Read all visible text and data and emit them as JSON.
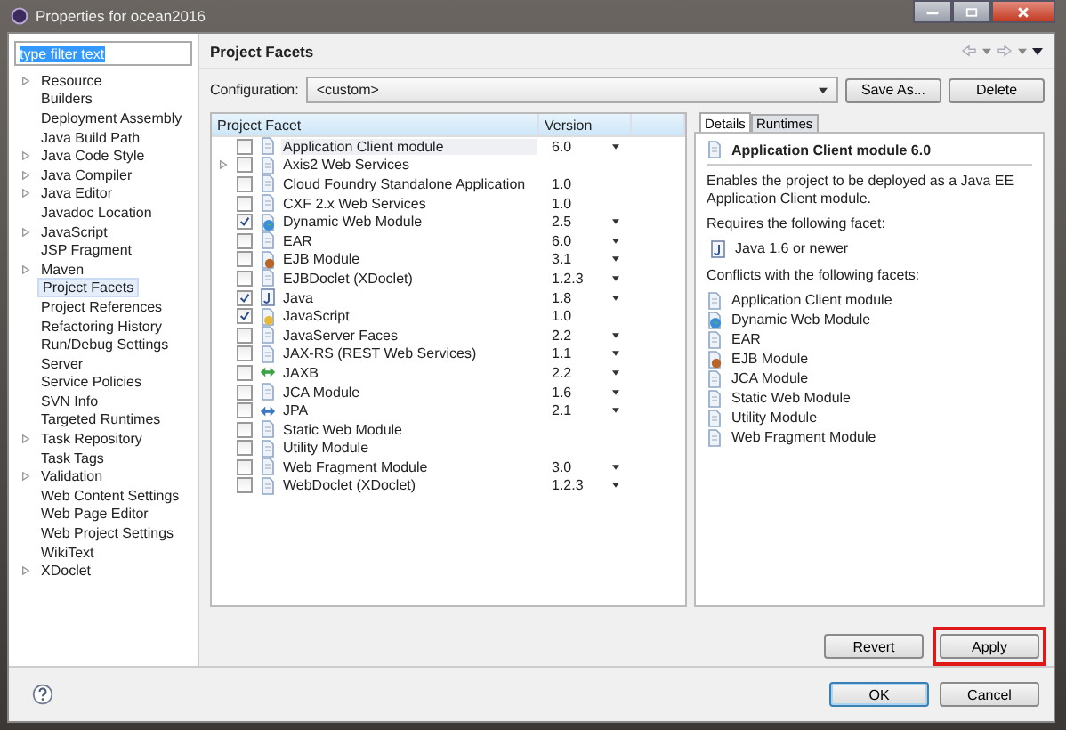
{
  "window": {
    "title": "Properties for ocean2016"
  },
  "filter": {
    "value": "type filter text"
  },
  "sidebar": {
    "items": [
      {
        "label": "Resource",
        "expandable": true,
        "selected": false
      },
      {
        "label": "Builders",
        "expandable": false,
        "selected": false
      },
      {
        "label": "Deployment Assembly",
        "expandable": false,
        "selected": false
      },
      {
        "label": "Java Build Path",
        "expandable": false,
        "selected": false
      },
      {
        "label": "Java Code Style",
        "expandable": true,
        "selected": false
      },
      {
        "label": "Java Compiler",
        "expandable": true,
        "selected": false
      },
      {
        "label": "Java Editor",
        "expandable": true,
        "selected": false
      },
      {
        "label": "Javadoc Location",
        "expandable": false,
        "selected": false
      },
      {
        "label": "JavaScript",
        "expandable": true,
        "selected": false
      },
      {
        "label": "JSP Fragment",
        "expandable": false,
        "selected": false
      },
      {
        "label": "Maven",
        "expandable": true,
        "selected": false
      },
      {
        "label": "Project Facets",
        "expandable": false,
        "selected": true
      },
      {
        "label": "Project References",
        "expandable": false,
        "selected": false
      },
      {
        "label": "Refactoring History",
        "expandable": false,
        "selected": false
      },
      {
        "label": "Run/Debug Settings",
        "expandable": false,
        "selected": false
      },
      {
        "label": "Server",
        "expandable": false,
        "selected": false
      },
      {
        "label": "Service Policies",
        "expandable": false,
        "selected": false
      },
      {
        "label": "SVN Info",
        "expandable": false,
        "selected": false
      },
      {
        "label": "Targeted Runtimes",
        "expandable": false,
        "selected": false
      },
      {
        "label": "Task Repository",
        "expandable": true,
        "selected": false
      },
      {
        "label": "Task Tags",
        "expandable": false,
        "selected": false
      },
      {
        "label": "Validation",
        "expandable": true,
        "selected": false
      },
      {
        "label": "Web Content Settings",
        "expandable": false,
        "selected": false
      },
      {
        "label": "Web Page Editor",
        "expandable": false,
        "selected": false
      },
      {
        "label": "Web Project Settings",
        "expandable": false,
        "selected": false
      },
      {
        "label": "WikiText",
        "expandable": false,
        "selected": false
      },
      {
        "label": "XDoclet",
        "expandable": true,
        "selected": false
      }
    ]
  },
  "page": {
    "title": "Project Facets",
    "configuration_label": "Configuration:",
    "configuration_value": "<custom>",
    "buttons": [
      "Save As...",
      "Delete"
    ]
  },
  "facets": {
    "columns": [
      "Project Facet",
      "Version"
    ],
    "rows": [
      {
        "name": "Application Client module",
        "kind": "document",
        "checked": false,
        "expandable": false,
        "selected": true,
        "version": "6.0",
        "has_versions": true
      },
      {
        "name": "Axis2 Web Services",
        "kind": "document",
        "checked": false,
        "expandable": true,
        "selected": false,
        "has_versions": false
      },
      {
        "name": "Cloud Foundry Standalone Application",
        "kind": "document",
        "checked": false,
        "expandable": false,
        "selected": false,
        "version": "1.0",
        "has_versions": false
      },
      {
        "name": "CXF 2.x Web Services",
        "kind": "document",
        "checked": false,
        "expandable": false,
        "selected": false,
        "version": "1.0",
        "has_versions": false
      },
      {
        "name": "Dynamic Web Module",
        "kind": "globe",
        "checked": true,
        "expandable": false,
        "selected": false,
        "version": "2.5",
        "has_versions": true
      },
      {
        "name": "EAR",
        "kind": "document",
        "checked": false,
        "expandable": false,
        "selected": false,
        "version": "6.0",
        "has_versions": true
      },
      {
        "name": "EJB Module",
        "kind": "bean",
        "checked": false,
        "expandable": false,
        "selected": false,
        "version": "3.1",
        "has_versions": true
      },
      {
        "name": "EJBDoclet (XDoclet)",
        "kind": "document",
        "checked": false,
        "expandable": false,
        "selected": false,
        "version": "1.2.3",
        "has_versions": true
      },
      {
        "name": "Java",
        "kind": "java",
        "checked": true,
        "expandable": false,
        "selected": false,
        "version": "1.8",
        "has_versions": true
      },
      {
        "name": "JavaScript",
        "kind": "script",
        "checked": true,
        "expandable": false,
        "selected": false,
        "version": "1.0",
        "has_versions": false
      },
      {
        "name": "JavaServer Faces",
        "kind": "document",
        "checked": false,
        "expandable": false,
        "selected": false,
        "version": "2.2",
        "has_versions": true
      },
      {
        "name": "JAX-RS (REST Web Services)",
        "kind": "document",
        "checked": false,
        "expandable": false,
        "selected": false,
        "version": "1.1",
        "has_versions": true
      },
      {
        "name": "JAXB",
        "kind": "green-arrows",
        "checked": false,
        "expandable": false,
        "selected": false,
        "version": "2.2",
        "has_versions": true
      },
      {
        "name": "JCA Module",
        "kind": "document",
        "checked": false,
        "expandable": false,
        "selected": false,
        "version": "1.6",
        "has_versions": true
      },
      {
        "name": "JPA",
        "kind": "blue-arrows",
        "checked": false,
        "expandable": false,
        "selected": false,
        "version": "2.1",
        "has_versions": true
      },
      {
        "name": "Static Web Module",
        "kind": "document",
        "checked": false,
        "expandable": false,
        "selected": false,
        "has_versions": false
      },
      {
        "name": "Utility Module",
        "kind": "document",
        "checked": false,
        "expandable": false,
        "selected": false,
        "has_versions": false
      },
      {
        "name": "Web Fragment Module",
        "kind": "document",
        "checked": false,
        "expandable": false,
        "selected": false,
        "version": "3.0",
        "has_versions": true
      },
      {
        "name": "WebDoclet (XDoclet)",
        "kind": "document",
        "checked": false,
        "expandable": false,
        "selected": false,
        "version": "1.2.3",
        "has_versions": true
      }
    ]
  },
  "details": {
    "tabs": [
      {
        "label": "Details",
        "selected": true
      },
      {
        "label": "Runtimes",
        "selected": false
      }
    ],
    "title": "Application Client module 6.0",
    "description": "Enables the project to be deployed as a Java EE Application Client module.",
    "requires_label": "Requires the following facet:",
    "requires": [
      {
        "name": "Java 1.6 or newer",
        "kind": "java"
      }
    ],
    "conflicts_label": "Conflicts with the following facets:",
    "conflicts": [
      {
        "name": "Application Client module",
        "kind": "document"
      },
      {
        "name": "Dynamic Web Module",
        "kind": "globe"
      },
      {
        "name": "EAR",
        "kind": "document"
      },
      {
        "name": "EJB Module",
        "kind": "bean"
      },
      {
        "name": "JCA Module",
        "kind": "document"
      },
      {
        "name": "Static Web Module",
        "kind": "document"
      },
      {
        "name": "Utility Module",
        "kind": "document"
      },
      {
        "name": "Web Fragment Module",
        "kind": "document"
      }
    ]
  },
  "page_buttons": [
    {
      "label": "Revert",
      "highlighted": false
    },
    {
      "label": "Apply",
      "highlighted": true
    }
  ],
  "dialog_buttons": [
    {
      "label": "OK",
      "default": true
    },
    {
      "label": "Cancel",
      "default": false
    }
  ]
}
